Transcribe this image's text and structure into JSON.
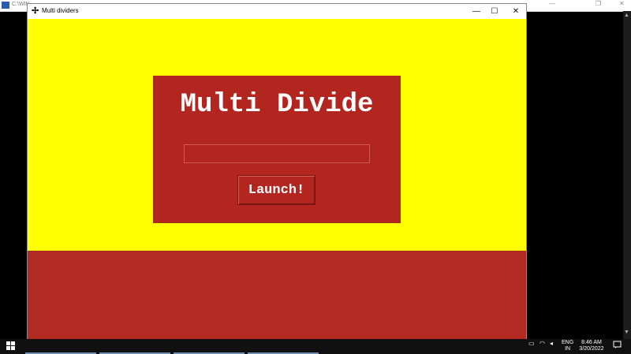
{
  "console": {
    "title": "C:\\WIN",
    "minimize": "—",
    "restore": "❐",
    "close": "✕",
    "scroll_up": "▲",
    "scroll_down": "▼"
  },
  "window": {
    "title": "Multi dividers",
    "app_icon": "✢",
    "minimize": "—",
    "maximize": "☐",
    "close": "✕"
  },
  "app": {
    "heading": "Multi Divide",
    "entry_value": "",
    "launch_label": "Launch!"
  },
  "colors": {
    "background_yellow": "#ffff00",
    "accent_red": "#b32620"
  },
  "taskbar": {
    "start_icon": "windows-logo-icon",
    "language_line1": "ENG",
    "language_line2": "IN",
    "time": "8:46 AM",
    "date": "3/20/2022",
    "notification_icon": "notification-icon"
  }
}
